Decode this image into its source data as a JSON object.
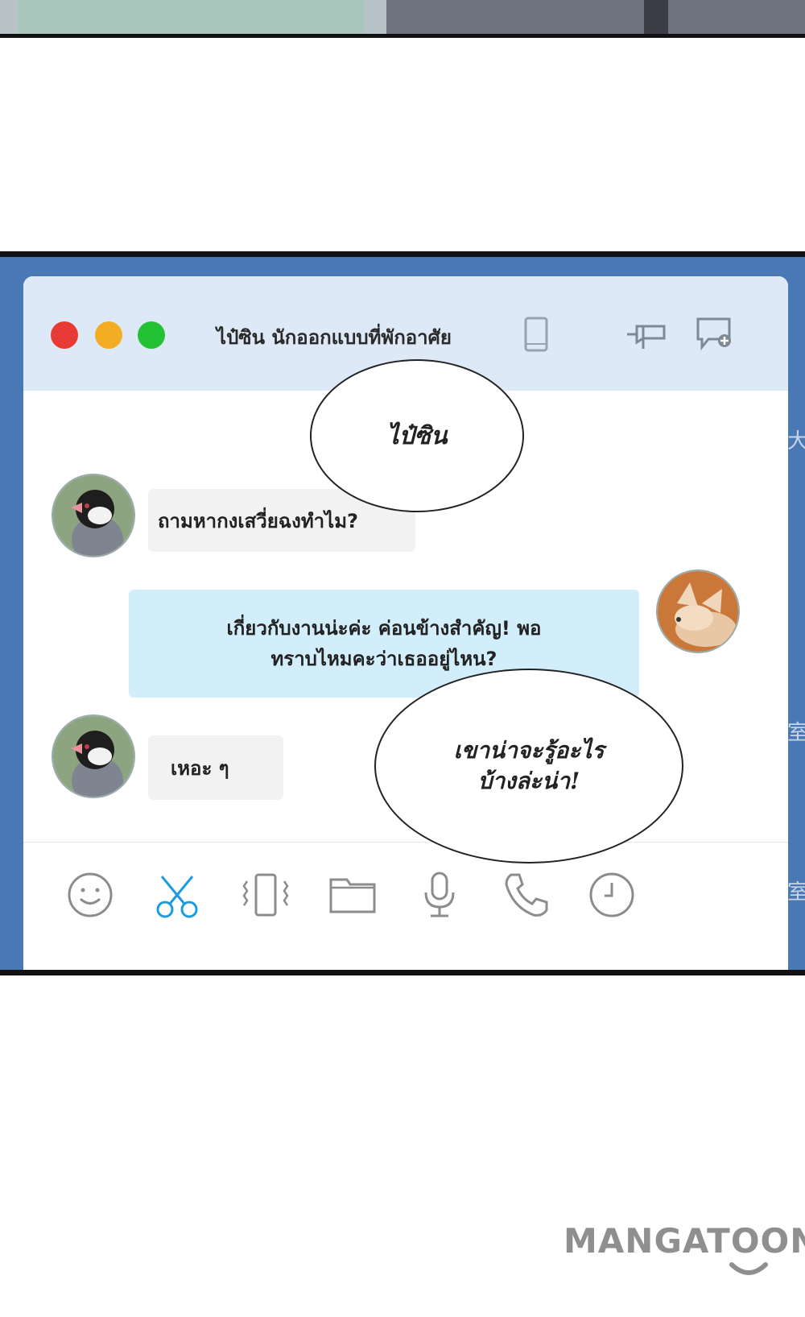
{
  "window": {
    "title": "ไป๋ซิน นักออกแบบที่พักอาศัย",
    "controls": [
      "close",
      "minimize",
      "maximize"
    ],
    "toolbar_icons": [
      "phone-icon",
      "pin-icon",
      "new-chat-icon"
    ]
  },
  "speech": {
    "top": "ไป๋ซิน",
    "bottom_line1": "เขาน่าจะรู้อะไร",
    "bottom_line2": "บ้างล่ะน่า!"
  },
  "messages": [
    {
      "side": "left",
      "avatar": "bird-avatar",
      "text": "ถามหากงเสวี่ยฉงทำไม?"
    },
    {
      "side": "right",
      "avatar": "fox-avatar",
      "line1": "เกี่ยวกับงานน่ะค่ะ ค่อนข้างสำคัญ! พอ",
      "line2": "ทราบไหมคะว่าเธออยู่ไหน?"
    },
    {
      "side": "left",
      "avatar": "bird-avatar",
      "text": "เหอะ ๆ"
    }
  ],
  "bottom_toolbar": [
    "emoji-icon",
    "scissors-icon",
    "shake-icon",
    "folder-icon",
    "microphone-icon",
    "call-icon",
    "clock-icon"
  ],
  "edge_chars": [
    "大",
    "室",
    "室"
  ],
  "watermark": "MANGATOON",
  "colors": {
    "panel_bg": "#4a78b5",
    "titlebar": "#dde9f7",
    "outgoing": "#d3eefb",
    "incoming": "#f2f2f2",
    "accent_scissors": "#1e9be0"
  }
}
